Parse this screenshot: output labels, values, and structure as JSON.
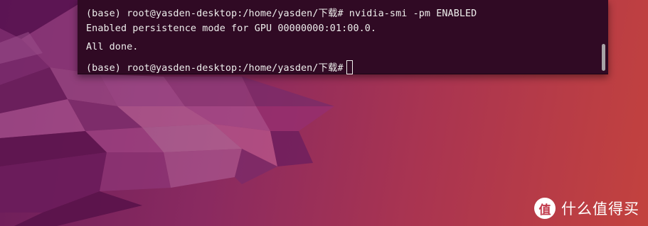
{
  "terminal": {
    "lines": {
      "l1": {
        "prompt": "(base) root@yasden-desktop:/home/yasden/下载#",
        "command": " nvidia-smi -pm ENABLED"
      },
      "l2": {
        "text": "Enabled persistence mode for GPU 00000000:01:00.0."
      },
      "l3": {
        "text": "All done."
      },
      "l4": {
        "prompt": "(base) root@yasden-desktop:/home/yasden/下载#"
      }
    },
    "colors": {
      "background": "#300a24",
      "foreground": "#eeeeec"
    }
  },
  "watermark": {
    "logo": "值",
    "text": "什么值得买"
  },
  "wallpaper": {
    "colors": [
      "#6b1d5a",
      "#a93451",
      "#c3423e"
    ]
  }
}
